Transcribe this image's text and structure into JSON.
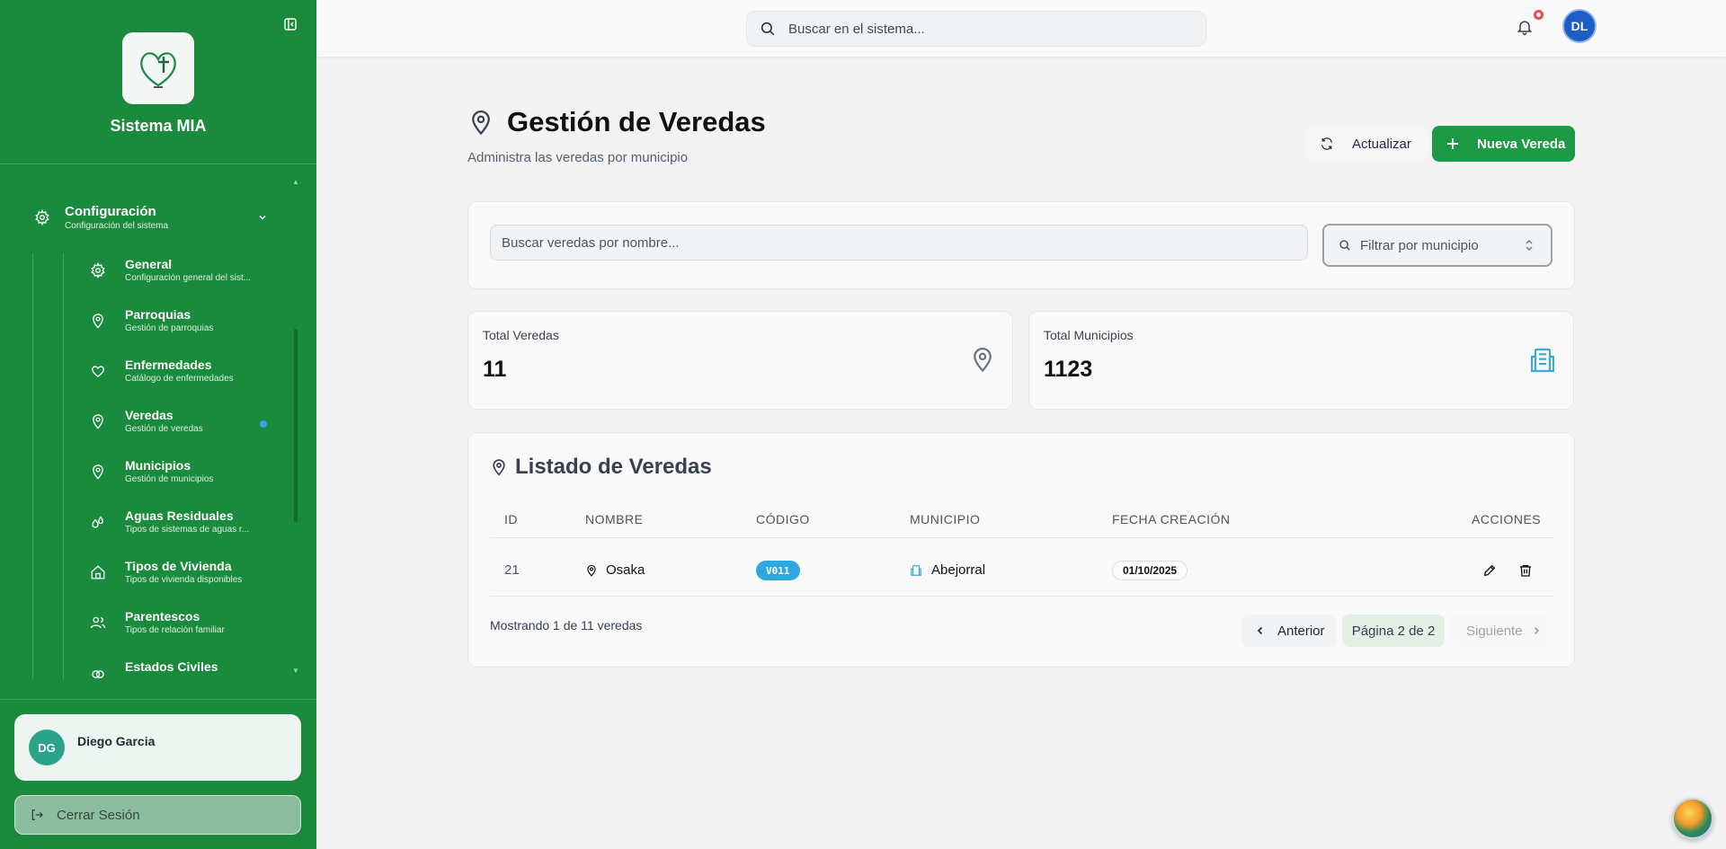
{
  "sidebar": {
    "app_title": "Sistema MIA",
    "config": {
      "label": "Configuración",
      "sub": "Configuración del sistema"
    },
    "items": [
      {
        "label": "General",
        "sub": "Configuración general del sist..."
      },
      {
        "label": "Parroquias",
        "sub": "Gestión de parroquias"
      },
      {
        "label": "Enfermedades",
        "sub": "Catálogo de enfermedades"
      },
      {
        "label": "Veredas",
        "sub": "Gestión de veredas"
      },
      {
        "label": "Municipios",
        "sub": "Gestión de municipios"
      },
      {
        "label": "Aguas Residuales",
        "sub": "Tipos de sistemas de aguas r..."
      },
      {
        "label": "Tipos de Vivienda",
        "sub": "Tipos de vivienda disponibles"
      },
      {
        "label": "Parentescos",
        "sub": "Tipos de relación familiar"
      },
      {
        "label": "Estados Civiles",
        "sub": ""
      }
    ],
    "user": {
      "initials": "DG",
      "name": "Diego Garcia"
    },
    "logout_label": "Cerrar Sesión"
  },
  "topbar": {
    "search_placeholder": "Buscar en el sistema...",
    "avatar_initials": "DL"
  },
  "page": {
    "title": "Gestión de Veredas",
    "subtitle": "Administra las veredas por municipio",
    "refresh_label": "Actualizar",
    "new_label": "Nueva Vereda"
  },
  "filters": {
    "search_placeholder": "Buscar veredas por nombre...",
    "municipio_placeholder": "Filtrar por municipio"
  },
  "stats": [
    {
      "label": "Total Veredas",
      "value": "11"
    },
    {
      "label": "Total Municipios",
      "value": "1123"
    }
  ],
  "list": {
    "title": "Listado de Veredas",
    "columns": [
      "ID",
      "NOMBRE",
      "CÓDIGO",
      "MUNICIPIO",
      "FECHA CREACIÓN",
      "ACCIONES"
    ],
    "rows": [
      {
        "id": "21",
        "nombre": "Osaka",
        "codigo": "V011",
        "municipio": "Abejorral",
        "fecha": "01/10/2025"
      }
    ],
    "showing": "Mostrando 1 de 11 veredas",
    "prev_label": "Anterior",
    "page_label": "Página 2 de 2",
    "next_label": "Siguiente"
  },
  "colors": {
    "sidebar_bg": "#1a8a3c",
    "primary_button": "#1d9a45",
    "code_badge": "#2ea8df",
    "notification_dot": "#e8494b",
    "avatar_bg": "#1d5ec4"
  }
}
